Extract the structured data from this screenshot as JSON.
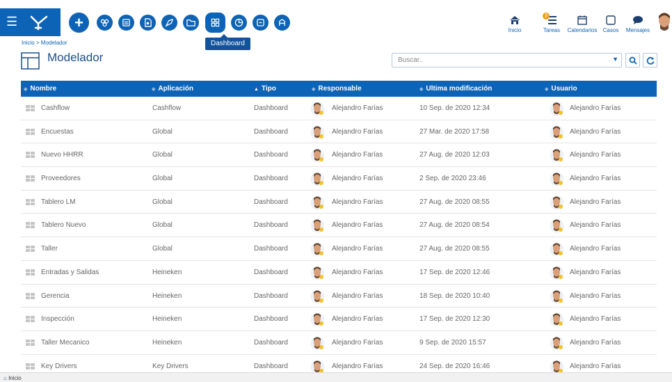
{
  "tooltip": "Dashboard",
  "topnav": [
    {
      "label": "Inicio",
      "icon": "home-icon"
    },
    {
      "label": "Tareas",
      "icon": "tasks-icon",
      "badge": "3"
    },
    {
      "label": "Calendarios",
      "icon": "calendar-icon"
    },
    {
      "label": "Casos",
      "icon": "cases-icon"
    },
    {
      "label": "Mensajes",
      "icon": "messages-icon"
    }
  ],
  "breadcrumb": "Inicio > Modelador",
  "page_title": "Modelador",
  "search": {
    "placeholder": "Buscar..",
    "value": ""
  },
  "columns": [
    "Nombre",
    "Aplicación",
    "Tipo",
    "Responsable",
    "Ultima modificación",
    "Usuario"
  ],
  "rows": [
    {
      "nombre": "Cashflow",
      "aplicacion": "Cashflow",
      "tipo": "Dashboard",
      "responsable": "Alejandro Farías",
      "modificacion": "10 Sep. de 2020 12:34",
      "usuario": "Alejandro Farías"
    },
    {
      "nombre": "Encuestas",
      "aplicacion": "Global",
      "tipo": "Dashboard",
      "responsable": "Alejandro Farías",
      "modificacion": "27 Mar. de 2020 17:58",
      "usuario": "Alejandro Farías"
    },
    {
      "nombre": "Nuevo HHRR",
      "aplicacion": "Global",
      "tipo": "Dashboard",
      "responsable": "Alejandro Farías",
      "modificacion": "27 Aug. de 2020 12:03",
      "usuario": "Alejandro Farías"
    },
    {
      "nombre": "Proveedores",
      "aplicacion": "Global",
      "tipo": "Dashboard",
      "responsable": "Alejandro Farías",
      "modificacion": "2 Sep. de 2020 23:46",
      "usuario": "Alejandro Farías"
    },
    {
      "nombre": "Tablero LM",
      "aplicacion": "Global",
      "tipo": "Dashboard",
      "responsable": "Alejandro Farías",
      "modificacion": "27 Aug. de 2020 08:55",
      "usuario": "Alejandro Farías"
    },
    {
      "nombre": "Tablero Nuevo",
      "aplicacion": "Global",
      "tipo": "Dashboard",
      "responsable": "Alejandro Farías",
      "modificacion": "27 Aug. de 2020 08:54",
      "usuario": "Alejandro Farías"
    },
    {
      "nombre": "Taller",
      "aplicacion": "Global",
      "tipo": "Dashboard",
      "responsable": "Alejandro Farías",
      "modificacion": "27 Aug. de 2020 08:55",
      "usuario": "Alejandro Farías"
    },
    {
      "nombre": "Entradas y Salidas",
      "aplicacion": "Heineken",
      "tipo": "Dashboard",
      "responsable": "Alejandro Farías",
      "modificacion": "17 Sep. de 2020 12:46",
      "usuario": "Alejandro Farías"
    },
    {
      "nombre": "Gerencia",
      "aplicacion": "Heineken",
      "tipo": "Dashboard",
      "responsable": "Alejandro Farías",
      "modificacion": "18 Sep. de 2020 10:40",
      "usuario": "Alejandro Farías"
    },
    {
      "nombre": "Inspección",
      "aplicacion": "Heineken",
      "tipo": "Dashboard",
      "responsable": "Alejandro Farías",
      "modificacion": "17 Sep. de 2020 12:30",
      "usuario": "Alejandro Farías"
    },
    {
      "nombre": "Taller Mecanico",
      "aplicacion": "Heineken",
      "tipo": "Dashboard",
      "responsable": "Alejandro Farías",
      "modificacion": "9 Sep. de 2020 15:57",
      "usuario": "Alejandro Farías"
    },
    {
      "nombre": "Key Drivers",
      "aplicacion": "Key Drivers",
      "tipo": "Dashboard",
      "responsable": "Alejandro Farías",
      "modificacion": "24 Sep. de 2020 16:46",
      "usuario": "Alejandro Farías"
    }
  ],
  "footer_tab": "Inicio",
  "colors": {
    "primary": "#0d63b5",
    "title": "#1b4f8a",
    "badge": "#f0a019"
  }
}
